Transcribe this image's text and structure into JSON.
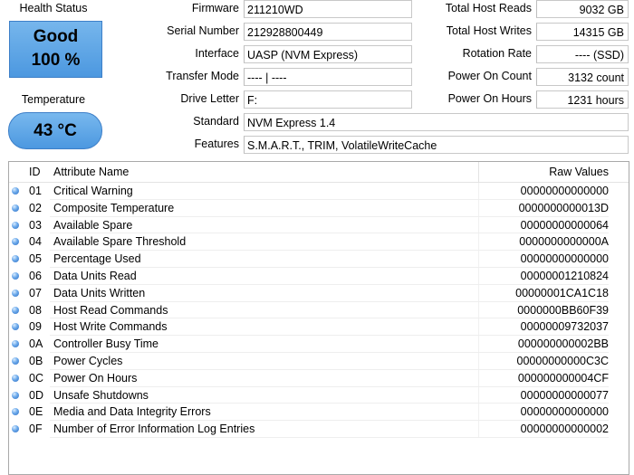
{
  "health": {
    "label": "Health Status",
    "status": "Good",
    "percent": "100 %",
    "color": "#5aa2e6"
  },
  "temperature": {
    "label": "Temperature",
    "value": "43 °C"
  },
  "info": {
    "firmware": {
      "label": "Firmware",
      "value": "211210WD"
    },
    "serial": {
      "label": "Serial Number",
      "value": "212928800449"
    },
    "interface": {
      "label": "Interface",
      "value": "UASP (NVM Express)"
    },
    "transfer_mode": {
      "label": "Transfer Mode",
      "value": "---- | ----"
    },
    "drive_letter": {
      "label": "Drive Letter",
      "value": "F:"
    },
    "standard": {
      "label": "Standard",
      "value": "NVM Express 1.4"
    },
    "features": {
      "label": "Features",
      "value": "S.M.A.R.T., TRIM, VolatileWriteCache"
    }
  },
  "stats": {
    "host_reads": {
      "label": "Total Host Reads",
      "value": "9032 GB"
    },
    "host_writes": {
      "label": "Total Host Writes",
      "value": "14315 GB"
    },
    "rotation": {
      "label": "Rotation Rate",
      "value": "---- (SSD)"
    },
    "power_count": {
      "label": "Power On Count",
      "value": "3132 count"
    },
    "power_hours": {
      "label": "Power On Hours",
      "value": "1231 hours"
    }
  },
  "table": {
    "headers": {
      "id": "ID",
      "name": "Attribute Name",
      "raw": "Raw Values"
    },
    "rows": [
      {
        "id": "01",
        "name": "Critical Warning",
        "raw": "00000000000000"
      },
      {
        "id": "02",
        "name": "Composite Temperature",
        "raw": "0000000000013D"
      },
      {
        "id": "03",
        "name": "Available Spare",
        "raw": "00000000000064"
      },
      {
        "id": "04",
        "name": "Available Spare Threshold",
        "raw": "0000000000000A"
      },
      {
        "id": "05",
        "name": "Percentage Used",
        "raw": "00000000000000"
      },
      {
        "id": "06",
        "name": "Data Units Read",
        "raw": "00000001210824"
      },
      {
        "id": "07",
        "name": "Data Units Written",
        "raw": "00000001CA1C18"
      },
      {
        "id": "08",
        "name": "Host Read Commands",
        "raw": "0000000BB60F39"
      },
      {
        "id": "09",
        "name": "Host Write Commands",
        "raw": "00000009732037"
      },
      {
        "id": "0A",
        "name": "Controller Busy Time",
        "raw": "000000000002BB"
      },
      {
        "id": "0B",
        "name": "Power Cycles",
        "raw": "00000000000C3C"
      },
      {
        "id": "0C",
        "name": "Power On Hours",
        "raw": "000000000004CF"
      },
      {
        "id": "0D",
        "name": "Unsafe Shutdowns",
        "raw": "00000000000077"
      },
      {
        "id": "0E",
        "name": "Media and Data Integrity Errors",
        "raw": "00000000000000"
      },
      {
        "id": "0F",
        "name": "Number of Error Information Log Entries",
        "raw": "00000000000002"
      }
    ]
  }
}
